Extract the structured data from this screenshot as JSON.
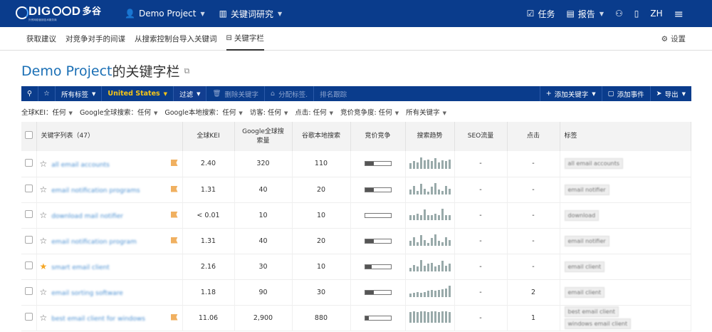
{
  "brand": {
    "name_a": "DIG",
    "name_b": "D",
    "name_c": "D",
    "cn": "多谷",
    "sub": "外贸网络营销技术服务商"
  },
  "topnav": {
    "project": "Demo Project",
    "research": "关键词研究",
    "tasks": "任务",
    "reports": "报告",
    "lang": "ZH"
  },
  "subnav": {
    "items": [
      "获取建议",
      "对竞争对手的间谍",
      "从搜索控制台导入关键词",
      "关键字栏"
    ],
    "settings": "设置"
  },
  "title": {
    "project": "Demo Project",
    "suffix": " 的关键字栏"
  },
  "toolbar": {
    "all_tags": "所有标签",
    "country": "United States",
    "filter": "过滤",
    "delete": "删除关键字",
    "assign": "分配标签.",
    "rank": "排名跟踪",
    "add_kw": "添加关键字",
    "add_event": "添加事件",
    "export": "导出"
  },
  "filters": [
    "全球KEI：任何",
    "Google全球搜索：任何",
    "Google本地搜索：任何",
    "访客: 任何",
    "点击: 任何",
    "竞价竞争度: 任何",
    "所有关键字"
  ],
  "table": {
    "headers": {
      "kw": "关键字列表（47）",
      "kei": "全球KEI",
      "global": "Google全球搜\n索量",
      "local": "谷歌本地搜索",
      "comp": "竞价竞争",
      "trend": "搜索趋势",
      "seo": "SEO流量",
      "clicks": "点击",
      "tags": "标签"
    },
    "rows": [
      {
        "kw": "all email accounts",
        "star": false,
        "flag": true,
        "kei": "2.40",
        "global": "320",
        "local": "110",
        "muted": false,
        "comp": 0.35,
        "trend": [
          6,
          8,
          7,
          12,
          9,
          10,
          8,
          11,
          7,
          9,
          8,
          10
        ],
        "seo": "-",
        "clicks": "-",
        "tags": [
          "all email accounts"
        ]
      },
      {
        "kw": "email notification programs",
        "star": false,
        "flag": true,
        "kei": "1.31",
        "global": "40",
        "local": "20",
        "muted": false,
        "comp": 0.35,
        "trend": [
          5,
          9,
          4,
          11,
          6,
          3,
          8,
          12,
          5,
          4,
          9,
          6
        ],
        "seo": "-",
        "clicks": "-",
        "tags": [
          "email notifier"
        ]
      },
      {
        "kw": "download mail notifier",
        "star": false,
        "flag": true,
        "kei": "< 0.01",
        "global": "10",
        "local": "10",
        "muted": true,
        "comp": 0.0,
        "trend": [
          6,
          6,
          7,
          6,
          12,
          6,
          6,
          7,
          6,
          13,
          6,
          6
        ],
        "seo": "-",
        "clicks": "-",
        "tags": [
          "download"
        ]
      },
      {
        "kw": "email notification program",
        "star": false,
        "flag": true,
        "kei": "1.31",
        "global": "40",
        "local": "20",
        "muted": false,
        "comp": 0.35,
        "trend": [
          5,
          9,
          4,
          11,
          6,
          3,
          8,
          12,
          5,
          4,
          9,
          6
        ],
        "seo": "-",
        "clicks": "-",
        "tags": [
          "email notifier"
        ]
      },
      {
        "kw": "smart email client",
        "star": true,
        "flag": false,
        "kei": "2.16",
        "global": "30",
        "local": "10",
        "muted": false,
        "comp": 0.25,
        "trend": [
          4,
          7,
          5,
          12,
          6,
          8,
          9,
          5,
          7,
          11,
          6,
          8
        ],
        "seo": "-",
        "clicks": "-",
        "tags": [
          "email client"
        ]
      },
      {
        "kw": "email sorting software",
        "star": false,
        "flag": false,
        "kei": "1.18",
        "global": "90",
        "local": "30",
        "muted": false,
        "comp": 0.35,
        "trend": [
          4,
          5,
          6,
          5,
          6,
          7,
          8,
          7,
          8,
          9,
          10,
          13
        ],
        "seo": "-",
        "clicks": "2",
        "tags": [
          "email client"
        ]
      },
      {
        "kw": "best email client for windows",
        "star": false,
        "flag": true,
        "kei": "11.06",
        "global": "2,900",
        "local": "880",
        "muted": false,
        "comp": 0.15,
        "trend": [
          11,
          12,
          11,
          12,
          12,
          11,
          12,
          12,
          11,
          12,
          12,
          11
        ],
        "seo": "-",
        "clicks": "1",
        "tags": [
          "best email client",
          "windows email client"
        ]
      }
    ]
  }
}
